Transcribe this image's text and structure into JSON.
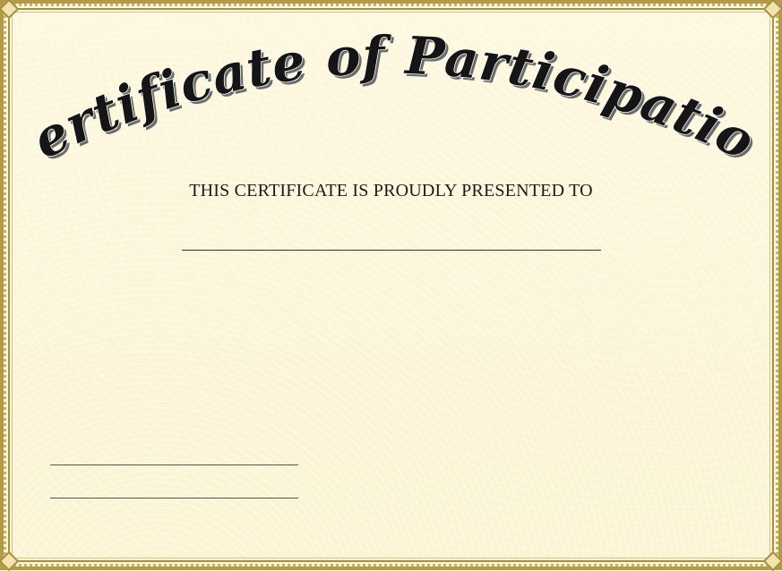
{
  "certificate": {
    "heading": "Certificate of Participation",
    "subtitle": "THIS CERTIFICATE IS PROUDLY PRESENTED TO"
  },
  "colors": {
    "background": "#fbf5d8",
    "border_gold": "#b39a4a",
    "heading_text": "#151515"
  }
}
